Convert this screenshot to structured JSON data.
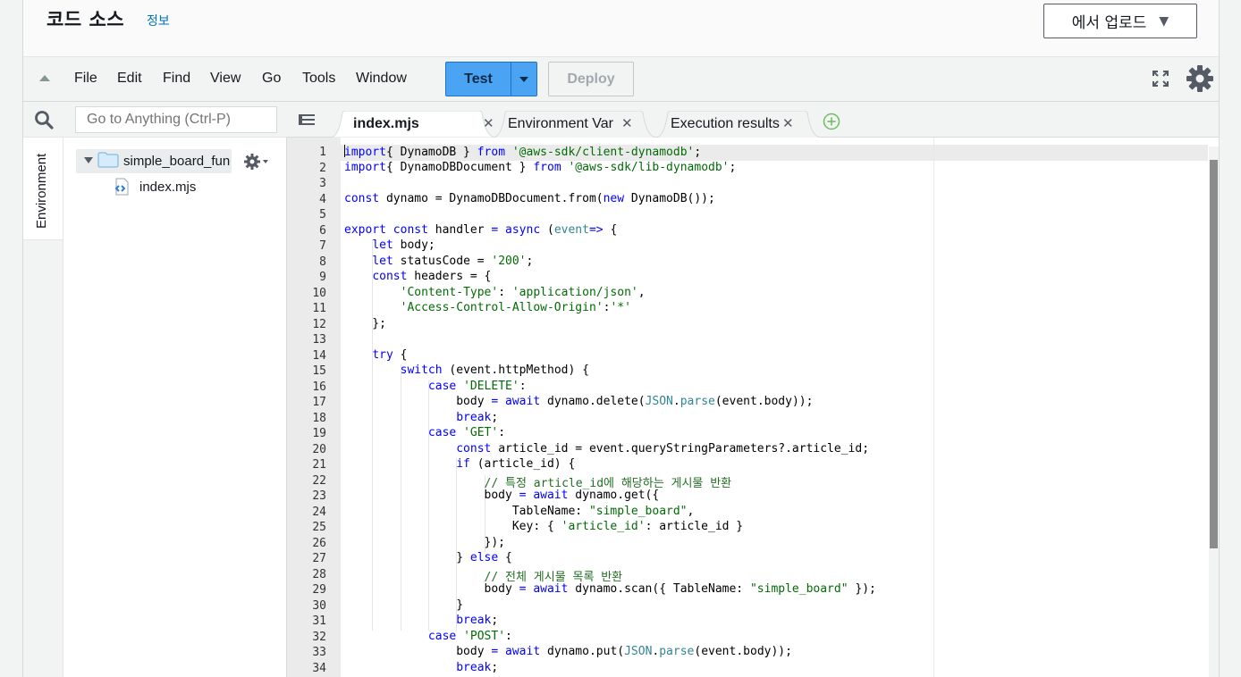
{
  "header": {
    "title": "코드 소스",
    "info_link": "정보",
    "upload_button": "에서 업로드"
  },
  "menubar": {
    "items": [
      "File",
      "Edit",
      "Find",
      "View",
      "Go",
      "Tools",
      "Window"
    ],
    "test_button": "Test",
    "deploy_button": "Deploy"
  },
  "search": {
    "placeholder": "Go to Anything (Ctrl-P)"
  },
  "sidebar": {
    "environment_tab": "Environment",
    "folder_name": "simple_board_funct",
    "file_name": "index.mjs"
  },
  "tabs": [
    {
      "label": "index.mjs",
      "active": true
    },
    {
      "label": "Environment Var",
      "active": false
    },
    {
      "label": "Execution results",
      "active": false
    }
  ],
  "editor": {
    "line_numbers": [
      "1",
      "2",
      "3",
      "4",
      "5",
      "6",
      "7",
      "8",
      "9",
      "10",
      "11",
      "12",
      "13",
      "14",
      "15",
      "16",
      "17",
      "18",
      "19",
      "20",
      "21",
      "22",
      "23",
      "24",
      "25",
      "26",
      "27",
      "28",
      "29",
      "30",
      "31",
      "32",
      "33",
      "34"
    ],
    "lines": [
      [
        [
          "kw",
          "import"
        ],
        [
          "",
          "{ DynamoDB } "
        ],
        [
          "kw",
          "from"
        ],
        [
          "",
          ""
        ],
        [
          "str",
          "'@aws-sdk/client-dynamodb'"
        ],
        [
          "",
          ";"
        ]
      ],
      [
        [
          "kw",
          "import"
        ],
        [
          "",
          "{ DynamoDBDocument } "
        ],
        [
          "kw",
          "from"
        ],
        [
          "",
          ""
        ],
        [
          "str",
          "'@aws-sdk/lib-dynamodb'"
        ],
        [
          "",
          ";"
        ]
      ],
      [],
      [
        [
          "kw",
          "const"
        ],
        [
          "",
          " dynamo = DynamoDBDocument.from("
        ],
        [
          "kw",
          "new"
        ],
        [
          "",
          " DynamoDB());"
        ]
      ],
      [],
      [
        [
          "kw",
          "export const"
        ],
        [
          "",
          " handler "
        ],
        [
          "kw",
          "="
        ],
        [
          "",
          ""
        ],
        [
          "kw",
          "async"
        ],
        [
          "",
          " ("
        ],
        [
          "sup",
          "event"
        ],
        [
          ") "
        ],
        [
          "kw",
          "=>"
        ],
        [
          "",
          " {"
        ]
      ],
      [
        [
          "",
          "    "
        ],
        [
          "kw",
          "let"
        ],
        [
          "",
          " body;"
        ]
      ],
      [
        [
          "",
          "    "
        ],
        [
          "kw",
          "let"
        ],
        [
          "",
          " statusCode = "
        ],
        [
          "str",
          "'200'"
        ],
        [
          "",
          ";"
        ]
      ],
      [
        [
          "",
          "    "
        ],
        [
          "kw",
          "const"
        ],
        [
          "",
          " headers = {"
        ]
      ],
      [
        [
          "",
          "        "
        ],
        [
          "str",
          "'Content-Type'"
        ],
        [
          "",
          ": "
        ],
        [
          "str",
          "'application/json'"
        ],
        [
          "",
          ","
        ]
      ],
      [
        [
          "",
          "        "
        ],
        [
          "str",
          "'Access-Control-Allow-Origin'"
        ],
        [
          "",
          ":"
        ],
        [
          "str",
          "'*'"
        ]
      ],
      [
        [
          "",
          "    };"
        ]
      ],
      [],
      [
        [
          "",
          "    "
        ],
        [
          "kw",
          "try"
        ],
        [
          "",
          " {"
        ]
      ],
      [
        [
          "",
          "        "
        ],
        [
          "kw",
          "switch"
        ],
        [
          "",
          " (event.httpMethod) {"
        ]
      ],
      [
        [
          "",
          "            "
        ],
        [
          "kw",
          "case"
        ],
        [
          "",
          ""
        ],
        [
          "str",
          "'DELETE'"
        ],
        [
          "",
          ":"
        ]
      ],
      [
        [
          "",
          "                body "
        ],
        [
          "kw",
          "="
        ],
        [
          "",
          ""
        ],
        [
          "kw",
          "await"
        ],
        [
          "",
          " dynamo.delete("
        ],
        [
          "sup",
          "JSON"
        ],
        [
          "",
          "."
        ],
        [
          "sup",
          "parse"
        ],
        [
          "",
          "(event.body));"
        ]
      ],
      [
        [
          "",
          "                "
        ],
        [
          "kw",
          "break"
        ],
        [
          "",
          ";"
        ]
      ],
      [
        [
          "",
          "            "
        ],
        [
          "kw",
          "case"
        ],
        [
          "",
          ""
        ],
        [
          "str",
          "'GET'"
        ],
        [
          "",
          ":"
        ]
      ],
      [
        [
          "",
          "                "
        ],
        [
          "kw",
          "const"
        ],
        [
          "",
          " article_id = event.queryStringParameters?.article_id;"
        ]
      ],
      [
        [
          "",
          "                "
        ],
        [
          "kw",
          "if"
        ],
        [
          "",
          " (article_id) {"
        ]
      ],
      [
        [
          "",
          "                    "
        ],
        [
          "cm",
          "// 특정 article_id에 해당하는 게시물 반환"
        ]
      ],
      [
        [
          "",
          "                    body "
        ],
        [
          "kw",
          "="
        ],
        [
          "",
          ""
        ],
        [
          "kw",
          "await"
        ],
        [
          "",
          " dynamo.get({"
        ]
      ],
      [
        [
          "",
          "                        TableName: "
        ],
        [
          "str",
          "\"simple_board\""
        ],
        [
          "",
          ","
        ]
      ],
      [
        [
          "",
          "                        Key: { "
        ],
        [
          "str",
          "'article_id'"
        ],
        [
          "",
          ": article_id }"
        ]
      ],
      [
        [
          "",
          "                    });"
        ]
      ],
      [
        [
          "",
          "                } "
        ],
        [
          "kw",
          "else"
        ],
        [
          "",
          " {"
        ]
      ],
      [
        [
          "",
          "                    "
        ],
        [
          "cm",
          "// 전체 게시물 목록 반환"
        ]
      ],
      [
        [
          "",
          "                    body "
        ],
        [
          "kw",
          "="
        ],
        [
          "",
          ""
        ],
        [
          "kw",
          "await"
        ],
        [
          "",
          " dynamo.scan({ TableName: "
        ],
        [
          "str",
          "\"simple_board\""
        ],
        [
          "",
          " });"
        ]
      ],
      [
        [
          "",
          "                }"
        ]
      ],
      [
        [
          "",
          "                "
        ],
        [
          "kw",
          "break"
        ],
        [
          "",
          ";"
        ]
      ],
      [
        [
          "",
          "            "
        ],
        [
          "kw",
          "case"
        ],
        [
          "",
          ""
        ],
        [
          "str",
          "'POST'"
        ],
        [
          "",
          ":"
        ]
      ],
      [
        [
          "",
          "                body "
        ],
        [
          "kw",
          "="
        ],
        [
          "",
          ""
        ],
        [
          "kw",
          "await"
        ],
        [
          "",
          " dynamo.put("
        ],
        [
          "sup",
          "JSON"
        ],
        [
          "",
          "."
        ],
        [
          "sup",
          "parse"
        ],
        [
          "",
          "(event.body));"
        ]
      ],
      [
        [
          "",
          "                "
        ],
        [
          "kw",
          "break"
        ],
        [
          "",
          ";"
        ]
      ]
    ]
  },
  "colors": {
    "keyword": "#0000ff",
    "string": "#036a07",
    "comment": "#236e24",
    "support": "#318495",
    "test_button": "#4ba3f4"
  },
  "icons": {
    "collapse": "triangle-up-icon",
    "fullscreen": "fullscreen-icon",
    "settings": "gear-icon",
    "search": "search-icon",
    "folder": "folder-icon",
    "file": "js-file-icon",
    "add_tab": "plus-circle-icon"
  }
}
